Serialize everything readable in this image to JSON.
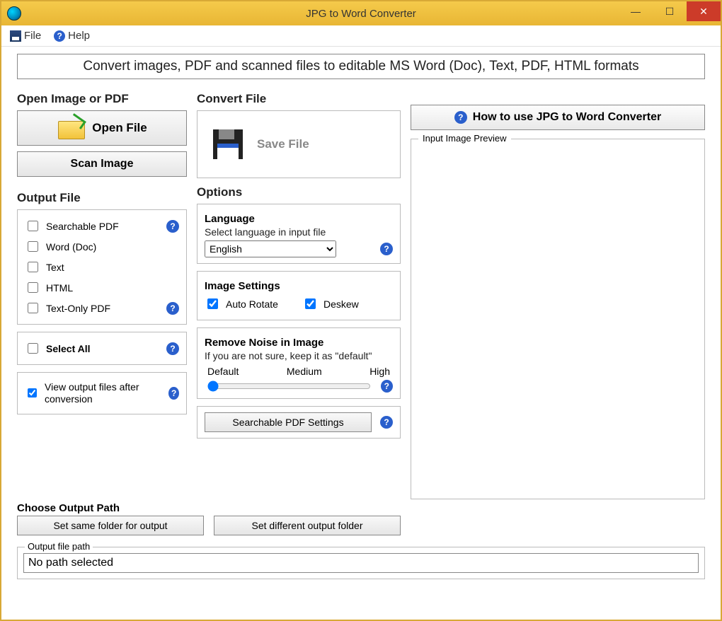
{
  "window": {
    "title": "JPG to Word Converter"
  },
  "menu": {
    "file": "File",
    "help": "Help"
  },
  "banner": "Convert images, PDF and scanned files to editable MS Word (Doc), Text, PDF, HTML formats",
  "open_section": {
    "title": "Open Image or PDF",
    "open_file": "Open File",
    "scan_image": "Scan Image"
  },
  "convert_section": {
    "title": "Convert File",
    "save_file": "Save File"
  },
  "output_section": {
    "title": "Output File",
    "formats": {
      "searchable_pdf": "Searchable PDF",
      "word": "Word (Doc)",
      "text": "Text",
      "html": "HTML",
      "textonly_pdf": "Text-Only PDF"
    },
    "select_all": "Select All",
    "view_after": "View output files after conversion"
  },
  "options": {
    "title": "Options",
    "language_title": "Language",
    "language_hint": "Select language in input file",
    "language_value": "English",
    "image_settings_title": "Image Settings",
    "auto_rotate": "Auto Rotate",
    "deskew": "Deskew",
    "noise_title": "Remove Noise in Image",
    "noise_hint": "If you are not sure, keep it as \"default\"",
    "noise_labels": {
      "default": "Default",
      "medium": "Medium",
      "high": "High"
    },
    "pdf_settings_btn": "Searchable PDF Settings"
  },
  "choose_path": {
    "title": "Choose Output Path",
    "same": "Set same folder for output",
    "diff": "Set different output folder"
  },
  "output_path": {
    "label": "Output file path",
    "value": "No path selected"
  },
  "right": {
    "howto": "How to use JPG to Word Converter",
    "preview_label": "Input Image Preview"
  }
}
